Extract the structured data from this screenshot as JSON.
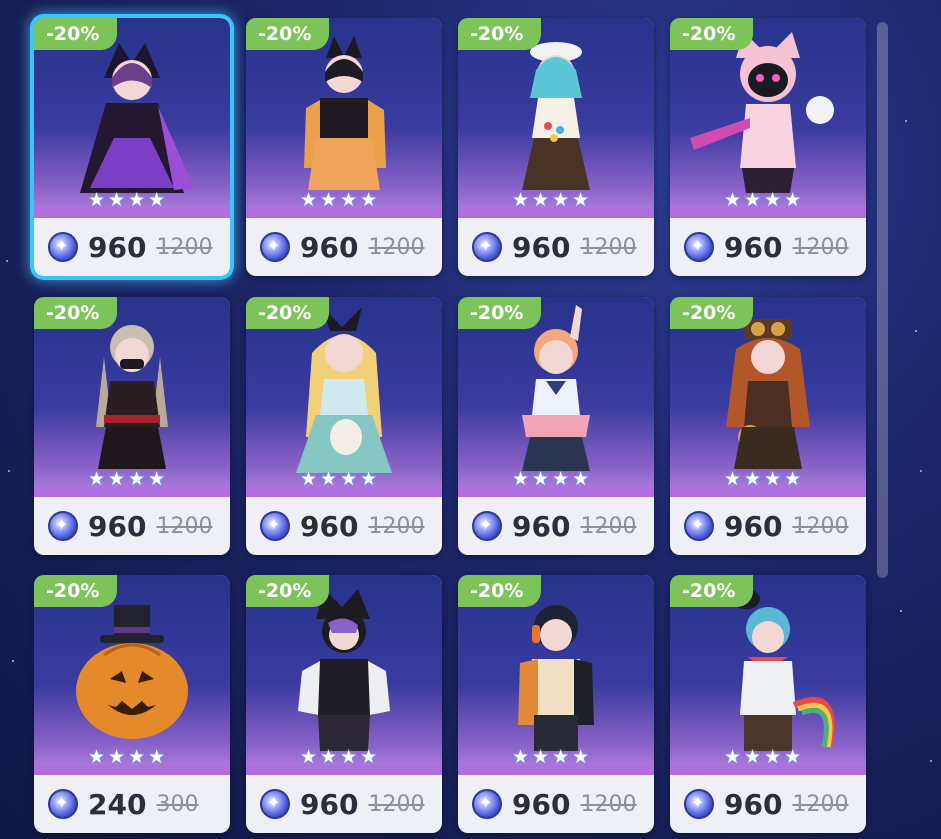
{
  "shop": {
    "items": [
      {
        "discount": "-20%",
        "price": "960",
        "original_price": "1200",
        "rarity": 4,
        "currency_icon": "crystal-gem-icon",
        "selected": true
      },
      {
        "discount": "-20%",
        "price": "960",
        "original_price": "1200",
        "rarity": 4,
        "currency_icon": "crystal-gem-icon",
        "selected": false
      },
      {
        "discount": "-20%",
        "price": "960",
        "original_price": "1200",
        "rarity": 4,
        "currency_icon": "crystal-gem-icon",
        "selected": false
      },
      {
        "discount": "-20%",
        "price": "960",
        "original_price": "1200",
        "rarity": 4,
        "currency_icon": "crystal-gem-icon",
        "selected": false
      },
      {
        "discount": "-20%",
        "price": "960",
        "original_price": "1200",
        "rarity": 4,
        "currency_icon": "crystal-gem-icon",
        "selected": false
      },
      {
        "discount": "-20%",
        "price": "960",
        "original_price": "1200",
        "rarity": 4,
        "currency_icon": "crystal-gem-icon",
        "selected": false
      },
      {
        "discount": "-20%",
        "price": "960",
        "original_price": "1200",
        "rarity": 4,
        "currency_icon": "crystal-gem-icon",
        "selected": false
      },
      {
        "discount": "-20%",
        "price": "960",
        "original_price": "1200",
        "rarity": 4,
        "currency_icon": "crystal-gem-icon",
        "selected": false
      },
      {
        "discount": "-20%",
        "price": "240",
        "original_price": "300",
        "rarity": 4,
        "currency_icon": "crystal-gem-icon",
        "selected": false
      },
      {
        "discount": "-20%",
        "price": "960",
        "original_price": "1200",
        "rarity": 4,
        "currency_icon": "crystal-gem-icon",
        "selected": false
      },
      {
        "discount": "-20%",
        "price": "960",
        "original_price": "1200",
        "rarity": 4,
        "currency_icon": "crystal-gem-icon",
        "selected": false
      },
      {
        "discount": "-20%",
        "price": "960",
        "original_price": "1200",
        "rarity": 4,
        "currency_icon": "crystal-gem-icon",
        "selected": false
      }
    ]
  },
  "colors": {
    "badge": "#7cc35a",
    "selection_glow": "#39c6ff",
    "card_bg": "#eef0f6",
    "price_text": "#2b2f3b",
    "strike_text": "#8d909c"
  }
}
